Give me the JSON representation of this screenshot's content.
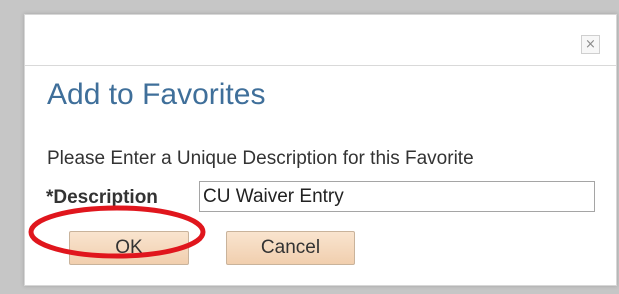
{
  "dialog": {
    "close_glyph": "×",
    "title": "Add to Favorites",
    "instruction": "Please Enter a Unique Description for this Favorite",
    "description_label": "*Description",
    "description_value": "CU Waiver Entry",
    "ok_label": "OK",
    "cancel_label": "Cancel"
  },
  "colors": {
    "title": "#3f6f9a",
    "button_fill": "#f4d8bb",
    "highlight_ring": "#e0161d"
  },
  "icons": {
    "close": "close-icon"
  }
}
